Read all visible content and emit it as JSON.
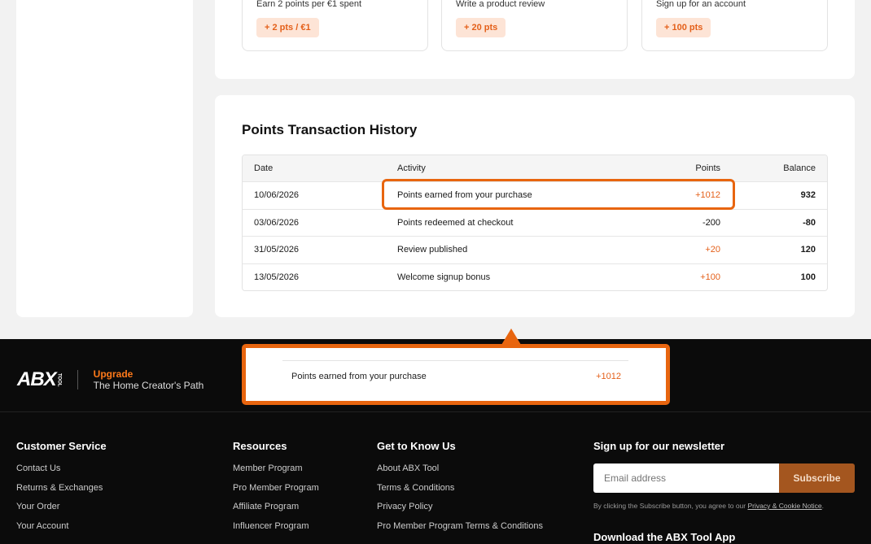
{
  "earn_cards": [
    {
      "description": "Earn 2 points per €1 spent",
      "reward": "+ 2 pts / €1"
    },
    {
      "description": "Write a product review",
      "reward": "+ 20 pts"
    },
    {
      "description": "Sign up for an account",
      "reward": "+ 100 pts"
    }
  ],
  "history": {
    "title": "Points Transaction History",
    "columns": {
      "date": "Date",
      "activity": "Activity",
      "points": "Points",
      "balance": "Balance"
    },
    "rows": [
      {
        "date": "10/06/2026",
        "activity": "Points earned from your purchase",
        "points": "+1012",
        "balance": "932"
      },
      {
        "date": "03/06/2026",
        "activity": "Points redeemed at checkout",
        "points": "-200",
        "balance": "-80"
      },
      {
        "date": "31/05/2026",
        "activity": "Review published",
        "points": "+20",
        "balance": "120"
      },
      {
        "date": "13/05/2026",
        "activity": "Welcome signup bonus",
        "points": "+100",
        "balance": "100"
      }
    ]
  },
  "popup": {
    "activity": "Points earned from your purchase",
    "points": "+1012"
  },
  "footer": {
    "logo": "ABX",
    "logo_sub": "TOOL",
    "upgrade": "Upgrade",
    "tagline": "The Home Creator's Path",
    "customer_service": {
      "title": "Customer Service",
      "links": [
        "Contact Us",
        "Returns & Exchanges",
        "Your Order",
        "Your Account"
      ]
    },
    "resources": {
      "title": "Resources",
      "links": [
        "Member Program",
        "Pro Member Program",
        "Affiliate Program",
        "Influencer Program"
      ]
    },
    "know_us": {
      "title": "Get to Know Us",
      "links": [
        "About ABX Tool",
        "Terms & Conditions",
        "Privacy Policy",
        "Pro Member Program Terms & Conditions"
      ]
    },
    "newsletter": {
      "title": "Sign up for our newsletter",
      "placeholder": "Email address",
      "button": "Subscribe",
      "note": "By clicking the Subscribe button, you agree to our",
      "note_link": "Privacy & Cookie Notice",
      "note_end": "."
    },
    "app_title": "Download the ABX Tool App"
  },
  "colors": {
    "accent": "#e8650f",
    "points_positive": "#e4601a",
    "subscribe": "#a4561f"
  }
}
